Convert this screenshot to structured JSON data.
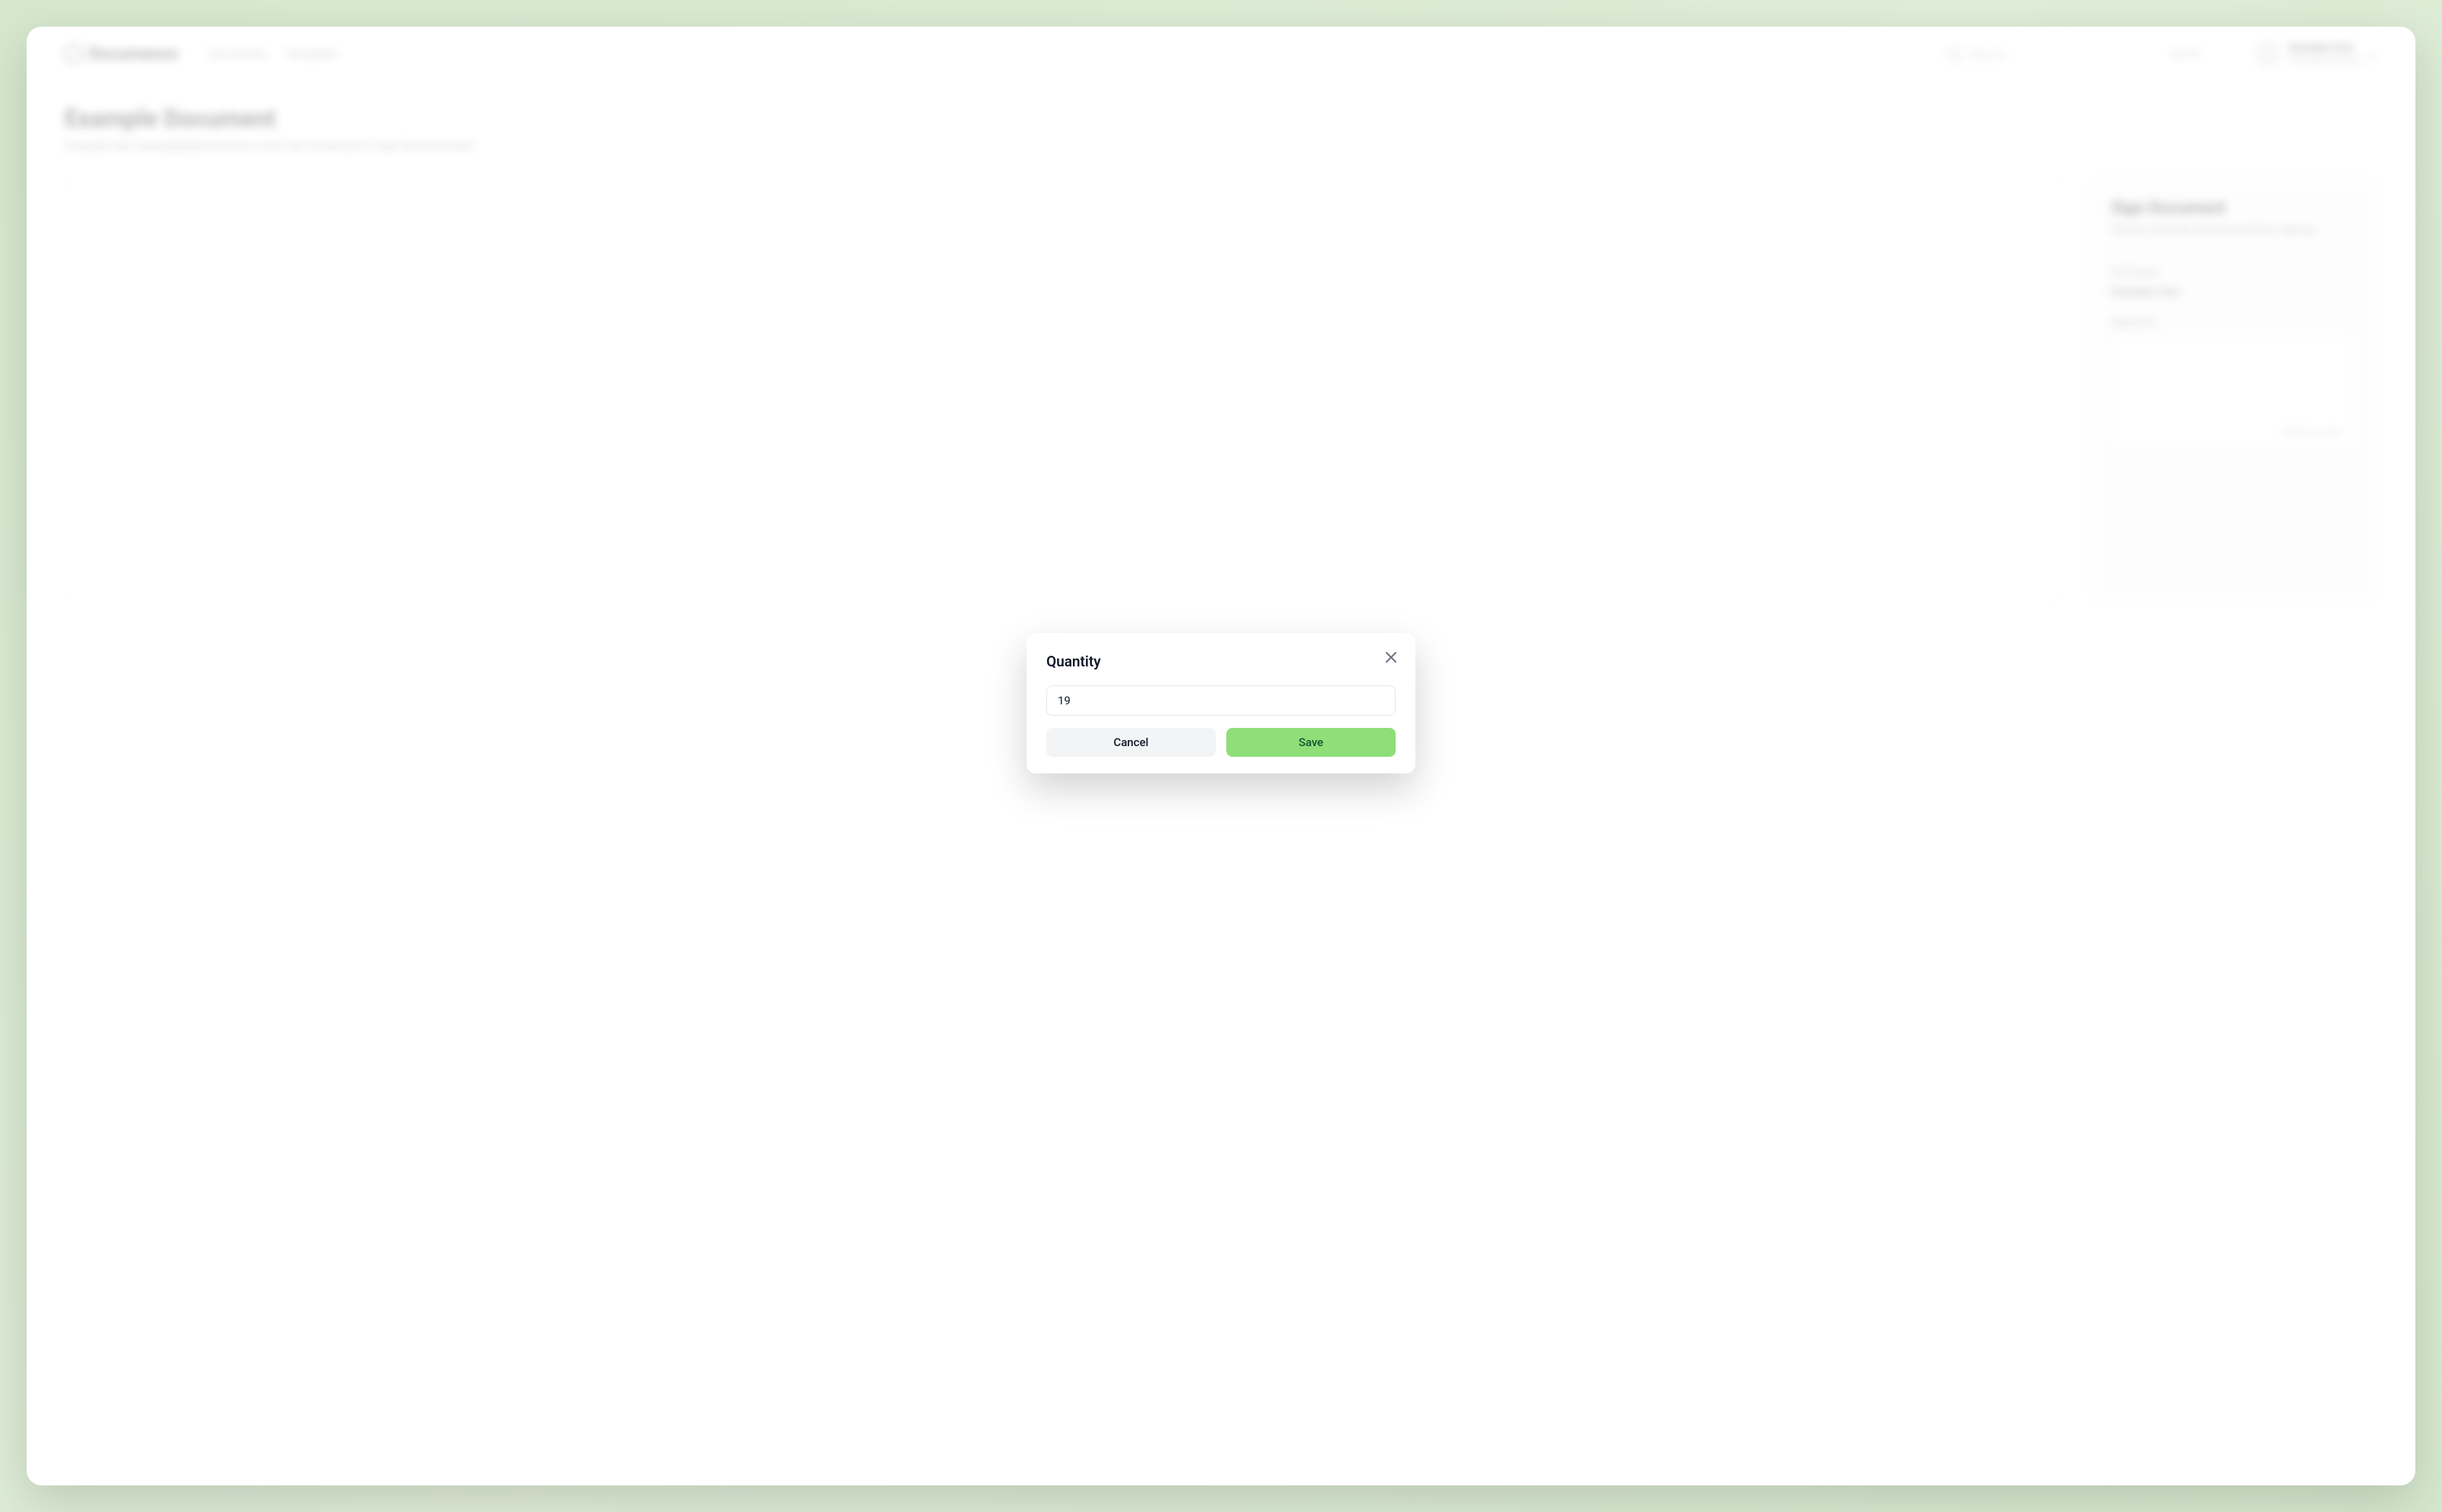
{
  "header": {
    "app_name": "Documenso",
    "nav": {
      "documents": "Documents",
      "templates": "Templates"
    },
    "search_placeholder": "Search",
    "language": "en-US",
    "user": {
      "name": "Example User",
      "account": "Personal Account"
    }
  },
  "page": {
    "title": "Example Document",
    "subtitle": "Example User (example@documenso.com) has invited you to sign this document"
  },
  "sign_panel": {
    "title": "Sign Document",
    "subtitle": "Please review the document before signing.",
    "full_name_label": "Full Name",
    "full_name_value": "Example User",
    "signature_label": "Signature",
    "signature_hint": "Click to insert"
  },
  "modal": {
    "title": "Quantity",
    "input_value": "19",
    "cancel_label": "Cancel",
    "save_label": "Save"
  }
}
